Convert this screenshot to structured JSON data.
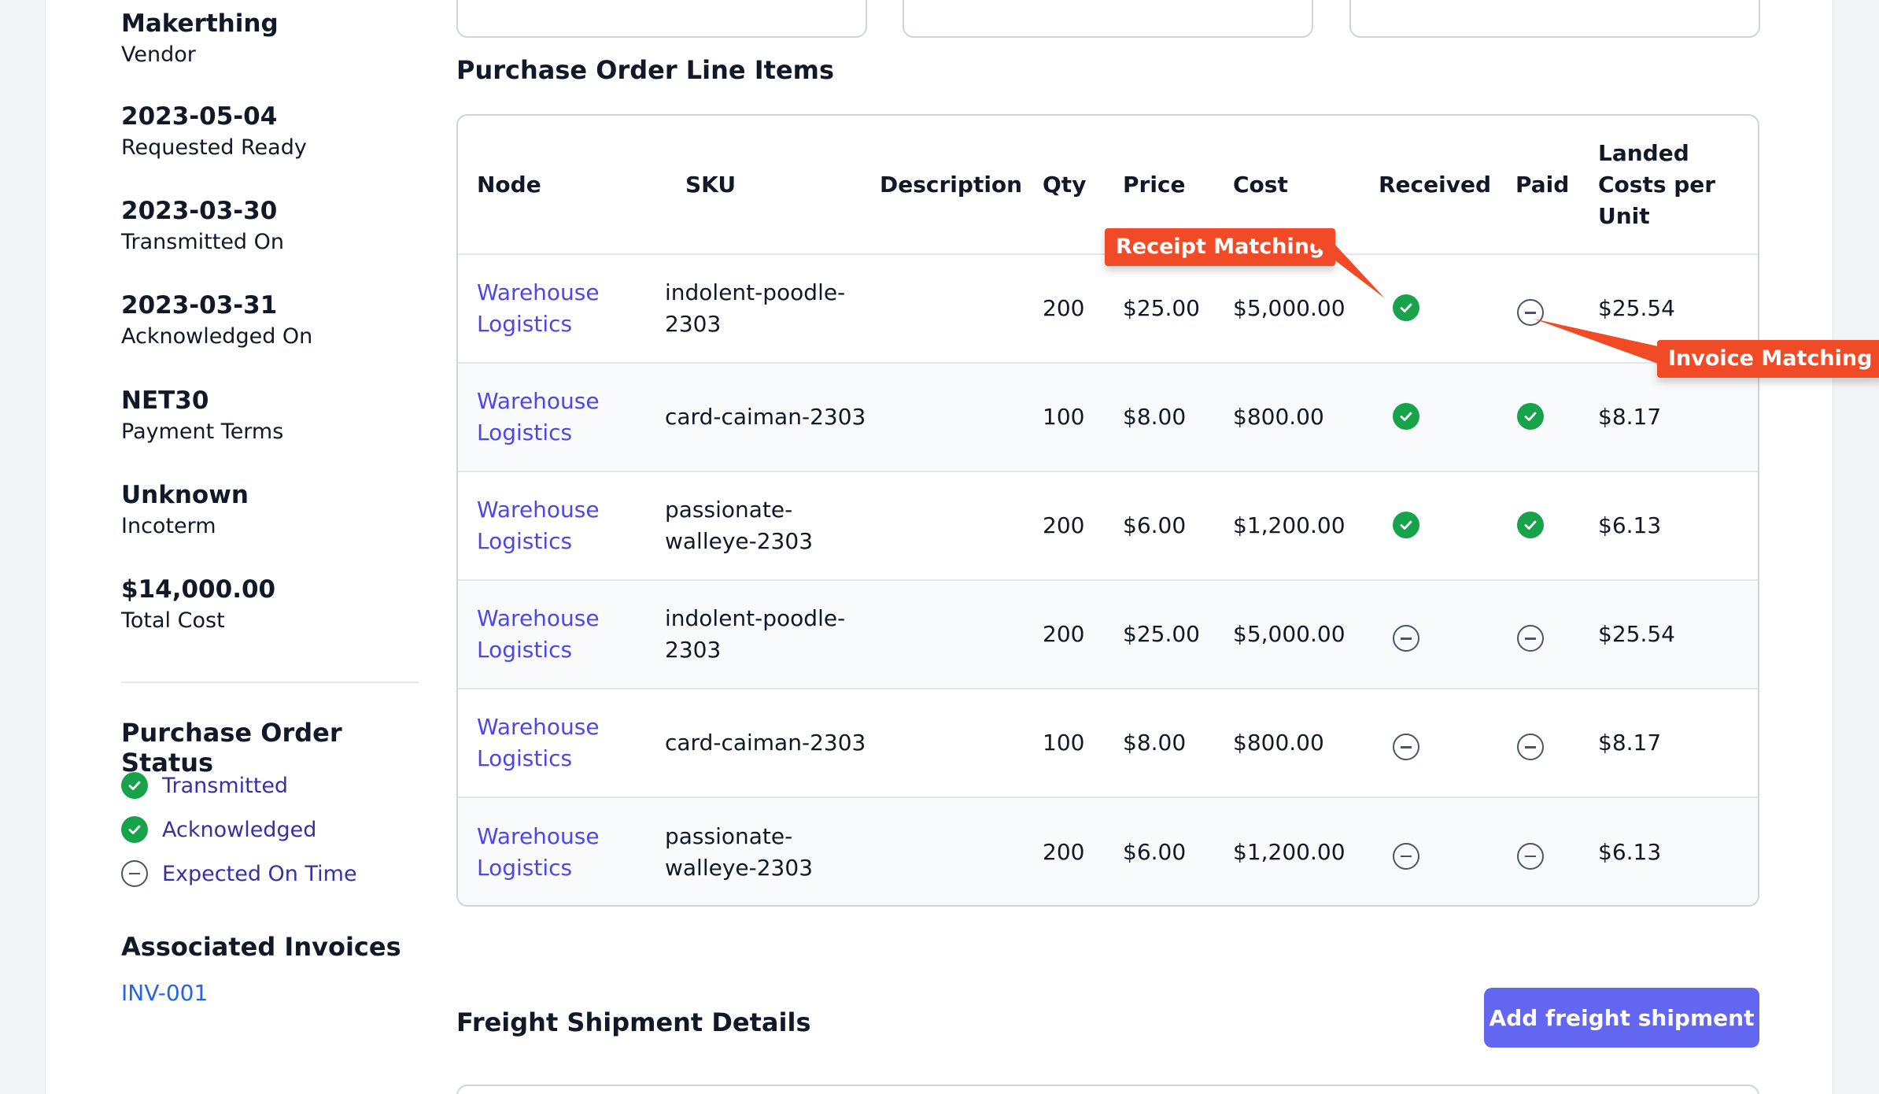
{
  "vendor": {
    "value": "Makerthing",
    "label": "Vendor"
  },
  "requested_ready": {
    "value": "2023-05-04",
    "label": "Requested Ready"
  },
  "transmitted_on": {
    "value": "2023-03-30",
    "label": "Transmitted On"
  },
  "acknowledged_on": {
    "value": "2023-03-31",
    "label": "Acknowledged On"
  },
  "payment_terms": {
    "value": "NET30",
    "label": "Payment Terms"
  },
  "incoterm": {
    "value": "Unknown",
    "label": "Incoterm"
  },
  "total_cost": {
    "value": "$14,000.00",
    "label": "Total Cost"
  },
  "po_status": {
    "heading": "Purchase Order Status",
    "items": [
      {
        "label": "Transmitted",
        "state": "done"
      },
      {
        "label": "Acknowledged",
        "state": "done"
      },
      {
        "label": "Expected On Time",
        "state": "pending"
      }
    ]
  },
  "invoices": {
    "heading": "Associated Invoices",
    "items": [
      "INV-001"
    ]
  },
  "line_items": {
    "title": "Purchase Order Line Items",
    "headers": [
      "Node",
      "SKU",
      "Description",
      "Qty",
      "Price",
      "Cost",
      "Received",
      "Paid",
      "Landed Costs per Unit"
    ],
    "rows": [
      {
        "node": "Warehouse Logistics",
        "sku": "indolent-poodle-2303",
        "description": "",
        "qty": "200",
        "price": "$25.00",
        "cost": "$5,000.00",
        "received": true,
        "paid": false,
        "landed": "$25.54"
      },
      {
        "node": "Warehouse Logistics",
        "sku": "card-caiman-2303",
        "description": "",
        "qty": "100",
        "price": "$8.00",
        "cost": "$800.00",
        "received": true,
        "paid": true,
        "landed": "$8.17"
      },
      {
        "node": "Warehouse Logistics",
        "sku": "passionate-walleye-2303",
        "description": "",
        "qty": "200",
        "price": "$6.00",
        "cost": "$1,200.00",
        "received": true,
        "paid": true,
        "landed": "$6.13"
      },
      {
        "node": "Warehouse Logistics",
        "sku": "indolent-poodle-2303",
        "description": "",
        "qty": "200",
        "price": "$25.00",
        "cost": "$5,000.00",
        "received": false,
        "paid": false,
        "landed": "$25.54"
      },
      {
        "node": "Warehouse Logistics",
        "sku": "card-caiman-2303",
        "description": "",
        "qty": "100",
        "price": "$8.00",
        "cost": "$800.00",
        "received": false,
        "paid": false,
        "landed": "$8.17"
      },
      {
        "node": "Warehouse Logistics",
        "sku": "passionate-walleye-2303",
        "description": "",
        "qty": "200",
        "price": "$6.00",
        "cost": "$1,200.00",
        "received": false,
        "paid": false,
        "landed": "$6.13"
      }
    ]
  },
  "callouts": {
    "receipt": "Receipt Matching",
    "invoice": "Invoice Matching"
  },
  "freight": {
    "title": "Freight Shipment Details",
    "add_button": "Add freight shipment"
  },
  "colors": {
    "accent": "#6366f1",
    "success": "#16a34a",
    "callout": "#f04a26",
    "link": "#4f46e5"
  },
  "icons": {
    "done": "check-circle-icon",
    "pending": "minus-circle-icon"
  }
}
